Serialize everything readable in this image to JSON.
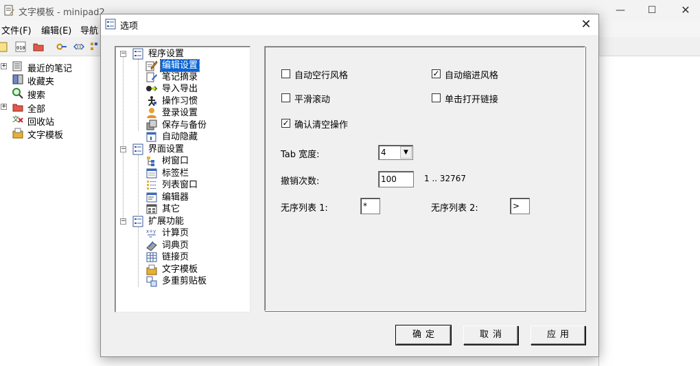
{
  "main_window": {
    "title": "文字模板 - minipad2",
    "menu": [
      "文件(F)",
      "编辑(E)",
      "导航"
    ],
    "sidebar": [
      {
        "label": "最近的笔记",
        "icon": "recent-notes-icon",
        "expandable": true
      },
      {
        "label": "收藏夹",
        "icon": "favorites-icon",
        "expandable": false
      },
      {
        "label": "搜索",
        "icon": "search-icon",
        "expandable": false
      },
      {
        "label": "全部",
        "icon": "folder-icon",
        "expandable": true
      },
      {
        "label": "回收站",
        "icon": "recycle-bin-icon",
        "expandable": false
      },
      {
        "label": "文字模板",
        "icon": "text-template-icon",
        "expandable": false
      }
    ]
  },
  "dialog": {
    "title": "选项",
    "close_glyph": "✕",
    "tree": [
      {
        "label": "程序设置",
        "level": 0,
        "icon": "settings-group-icon",
        "expander": "−"
      },
      {
        "label": "编辑设置",
        "level": 1,
        "icon": "edit-settings-icon",
        "selected": true
      },
      {
        "label": "笔记摘录",
        "level": 1,
        "icon": "note-excerpt-icon"
      },
      {
        "label": "导入导出",
        "level": 1,
        "icon": "import-export-icon"
      },
      {
        "label": "操作习惯",
        "level": 1,
        "icon": "habits-icon"
      },
      {
        "label": "登录设置",
        "level": 1,
        "icon": "login-icon"
      },
      {
        "label": "保存与备份",
        "level": 1,
        "icon": "save-backup-icon"
      },
      {
        "label": "自动隐藏",
        "level": 1,
        "icon": "auto-hide-icon"
      },
      {
        "label": "界面设置",
        "level": 0,
        "icon": "settings-group-icon",
        "expander": "−"
      },
      {
        "label": "树窗口",
        "level": 1,
        "icon": "tree-window-icon"
      },
      {
        "label": "标签栏",
        "level": 1,
        "icon": "tab-bar-icon"
      },
      {
        "label": "列表窗口",
        "level": 1,
        "icon": "list-window-icon"
      },
      {
        "label": "编辑器",
        "level": 1,
        "icon": "editor-icon"
      },
      {
        "label": "其它",
        "level": 1,
        "icon": "other-icon"
      },
      {
        "label": "扩展功能",
        "level": 0,
        "icon": "settings-group-icon",
        "expander": "−"
      },
      {
        "label": "计算页",
        "level": 1,
        "icon": "calculator-icon"
      },
      {
        "label": "词典页",
        "level": 1,
        "icon": "dictionary-icon"
      },
      {
        "label": "链接页",
        "level": 1,
        "icon": "link-page-icon"
      },
      {
        "label": "文字模板",
        "level": 1,
        "icon": "text-template-icon"
      },
      {
        "label": "多重剪贴板",
        "level": 1,
        "icon": "multi-clipboard-icon"
      }
    ],
    "options": {
      "auto_blank_line": {
        "label": "自动空行风格",
        "checked": false
      },
      "auto_indent": {
        "label": "自动缩进风格",
        "checked": true
      },
      "smooth_scroll": {
        "label": "平滑滚动",
        "checked": false
      },
      "single_click_link": {
        "label": "单击打开链接",
        "checked": false
      },
      "confirm_clear": {
        "label": "确认清空操作",
        "checked": true
      },
      "check_glyph": "✓",
      "tab_width": {
        "label": "Tab 宽度:",
        "value": "4"
      },
      "undo_count": {
        "label": "撤销次数:",
        "value": "100",
        "range": "1 .. 32767"
      },
      "bullet1": {
        "label": "无序列表 1:",
        "value": "*"
      },
      "bullet2": {
        "label": "无序列表 2:",
        "value": ">"
      }
    },
    "buttons": {
      "ok": "确定",
      "cancel": "取消",
      "apply": "应用"
    }
  }
}
